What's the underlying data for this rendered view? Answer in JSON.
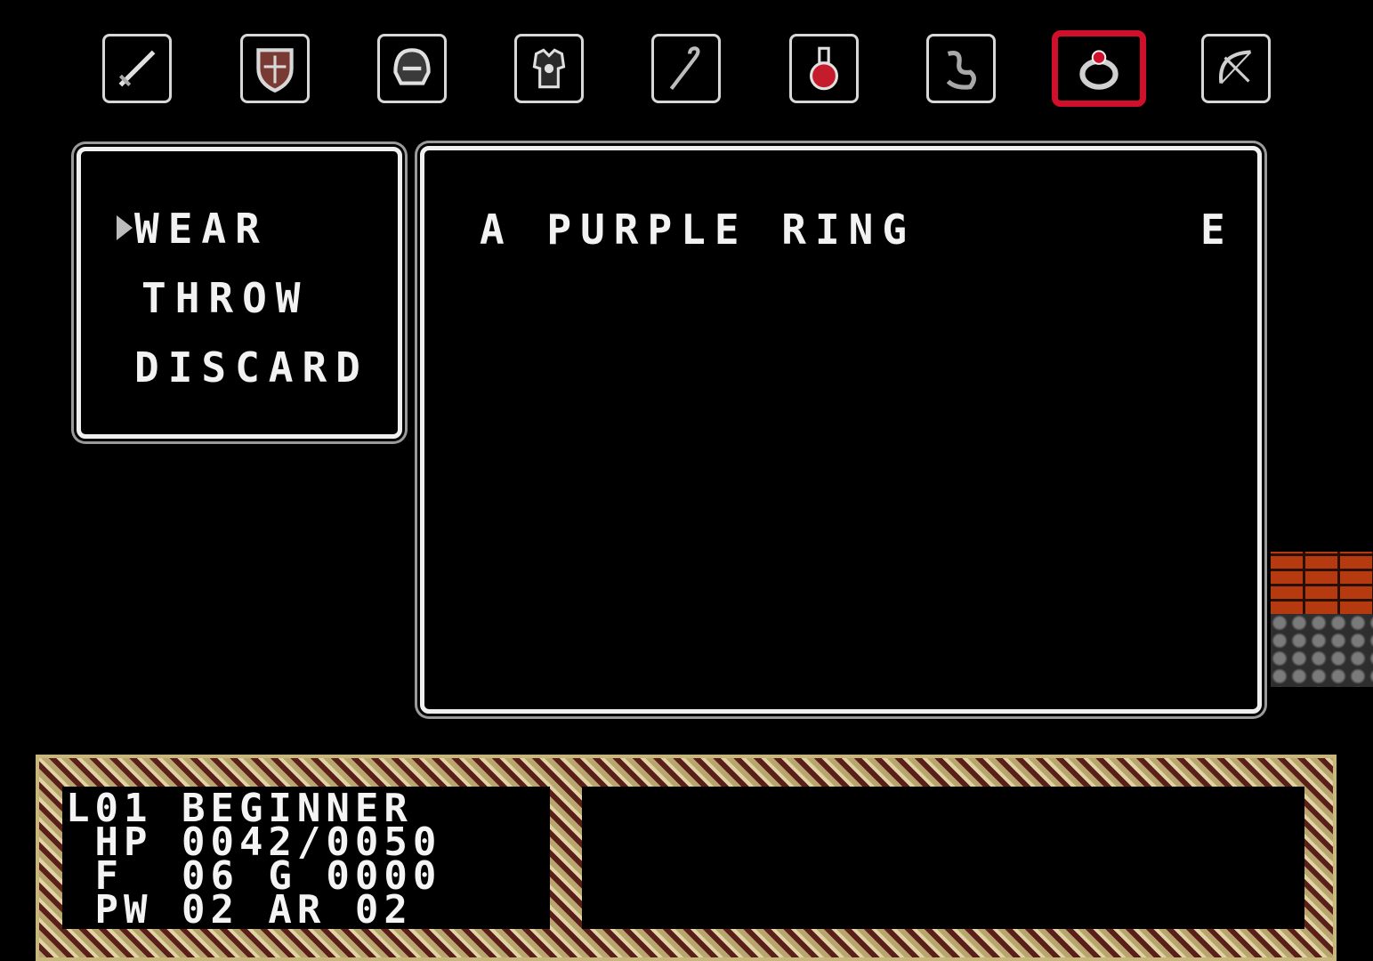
{
  "inventory_bar": {
    "slots": [
      {
        "icon": "sword-icon",
        "selected": false
      },
      {
        "icon": "shield-icon",
        "selected": false
      },
      {
        "icon": "helmet-icon",
        "selected": false
      },
      {
        "icon": "armor-icon",
        "selected": false
      },
      {
        "icon": "staff-icon",
        "selected": false
      },
      {
        "icon": "potion-icon",
        "selected": false
      },
      {
        "icon": "scroll-icon",
        "selected": false
      },
      {
        "icon": "ring-icon",
        "selected": true
      },
      {
        "icon": "bow-icon",
        "selected": false
      }
    ],
    "selected_color": "#d0102a"
  },
  "command_menu": {
    "items": [
      "WEAR",
      "THROW",
      "DISCARD"
    ],
    "cursor_index": 0
  },
  "item_panel": {
    "item_name": "A PURPLE RING",
    "equipped_marker": "E"
  },
  "status": {
    "line1": "L01 BEGINNER",
    "line2": " HP 0042/0050",
    "line3": " F  06 G 0000",
    "line4": " PW 02 AR 02"
  }
}
